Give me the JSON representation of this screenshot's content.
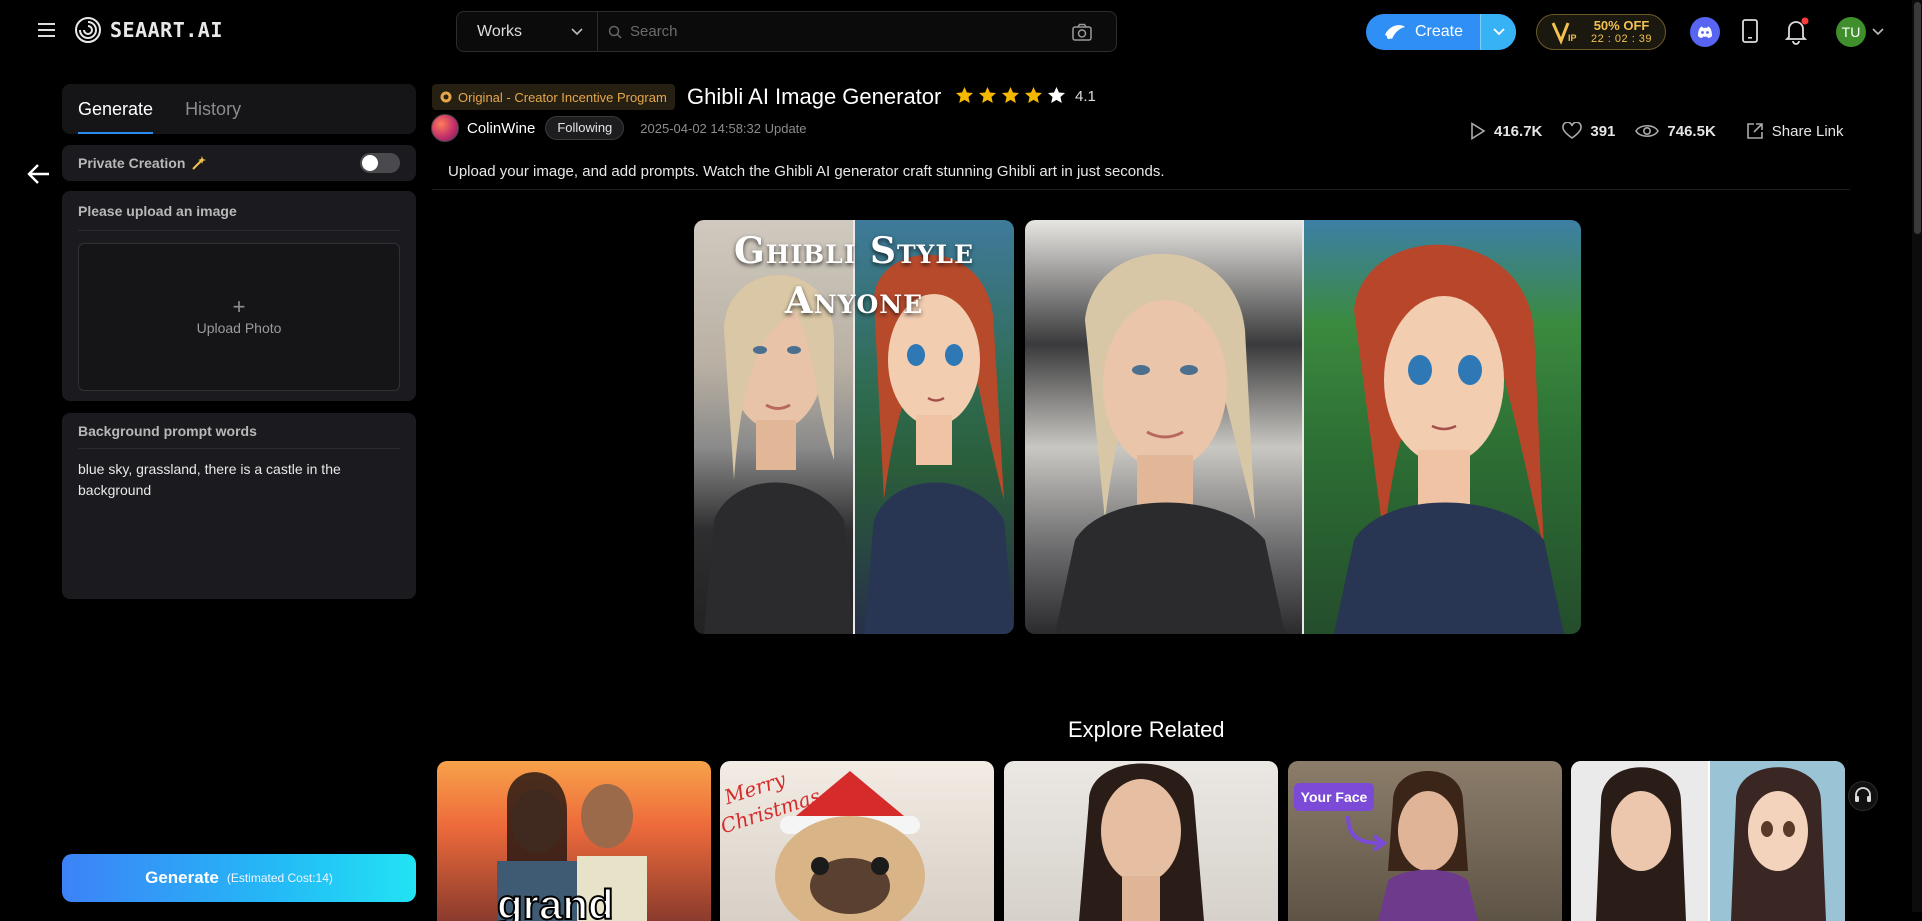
{
  "header": {
    "logo_text": "SEAART.AI",
    "search_category": "Works",
    "search_placeholder": "Search",
    "create_label": "Create",
    "vip": {
      "offer": "50% OFF",
      "timer": "22 : 02 : 39"
    },
    "avatar_initials": "TU"
  },
  "left_panel": {
    "tabs": [
      "Generate",
      "History"
    ],
    "active_tab": "Generate",
    "private_creation_label": "Private Creation",
    "private_creation_enabled": false,
    "upload_title": "Please upload an image",
    "upload_label": "Upload Photo",
    "prompt_title": "Background prompt words",
    "prompt_value": "blue sky, grassland, there is a castle in the background",
    "generate_label": "Generate",
    "generate_cost": "(Estimated Cost:14)"
  },
  "main": {
    "badge": "Original - Creator Incentive Program",
    "title": "Ghibli AI Image Generator",
    "rating": "4.1",
    "rating_value": 4.1,
    "author": "ColinWine",
    "follow_label": "Following",
    "update_time": "2025-04-02 14:58:32 Update",
    "stats": {
      "runs": "416.7K",
      "likes": "391",
      "views": "746.5K"
    },
    "share_label": "Share Link",
    "description": "Upload your image, and add prompts. Watch the Ghibli AI generator craft stunning Ghibli art in just seconds.",
    "hero_overlay_line1": "Ghibli Style",
    "hero_overlay_line2": "Anyone",
    "explore_title": "Explore Related",
    "related_badges": {
      "merry": "Merry Christmas",
      "your_face": "Your Face",
      "grand": "grand"
    }
  },
  "colors": {
    "accent": "#2c8cf0",
    "badge_text": "#e5a64a",
    "vip_gold": "#f2c14e",
    "star": "#f5b800",
    "avatar_bg": "#3f8f2c"
  }
}
